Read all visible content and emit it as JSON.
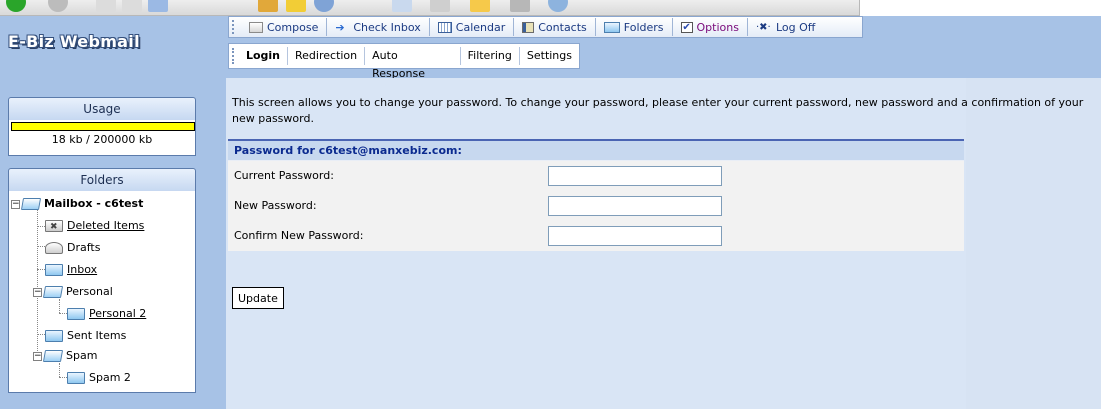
{
  "app": {
    "logo_text": "E-Biz Webmail"
  },
  "nav": {
    "items": [
      {
        "label": "Compose",
        "icon": "compose-icon"
      },
      {
        "label": "Check Inbox",
        "icon": "arrow-right-icon"
      },
      {
        "label": "Calendar",
        "icon": "calendar-icon"
      },
      {
        "label": "Contacts",
        "icon": "contacts-icon"
      },
      {
        "label": "Folders",
        "icon": "folder-icon"
      },
      {
        "label": "Options",
        "icon": "checkbox-icon",
        "selected": true
      },
      {
        "label": "Log Off",
        "icon": "log-off-icon"
      }
    ]
  },
  "subtabs": [
    "Login",
    "Redirection",
    "Auto Response",
    "Filtering",
    "Settings"
  ],
  "usage": {
    "title": "Usage",
    "text": "18 kb / 200000 kb",
    "used_fraction": 9e-05,
    "bar_color": "#ffff00"
  },
  "folders": {
    "title": "Folders",
    "items": [
      {
        "label": "Mailbox - c6test",
        "bold": true,
        "link": false
      },
      {
        "label": "Deleted Items",
        "link": true
      },
      {
        "label": "Drafts",
        "link": false
      },
      {
        "label": "Inbox",
        "link": true
      },
      {
        "label": "Personal",
        "link": false
      },
      {
        "label": "Personal 2",
        "link": true
      },
      {
        "label": "Sent Items",
        "link": false
      },
      {
        "label": "Spam",
        "link": false
      },
      {
        "label": "Spam 2",
        "link": false
      }
    ]
  },
  "main": {
    "intro": "This screen allows you to change your password. To change your password, please enter your current password, new password and a confirmation of your new password.",
    "form_title": "Password for c6test@manxebiz.com:",
    "fields": [
      {
        "label": "Current Password:",
        "value": ""
      },
      {
        "label": "New Password:",
        "value": ""
      },
      {
        "label": "Confirm New Password:",
        "value": ""
      }
    ],
    "update_label": "Update"
  },
  "colors": {
    "background": "#a7c2e6",
    "content": "#d9e5f5",
    "form_header": "#c7d8ef",
    "form_title_text": "#0b2a8f",
    "nav_text": "#1b3a82"
  }
}
